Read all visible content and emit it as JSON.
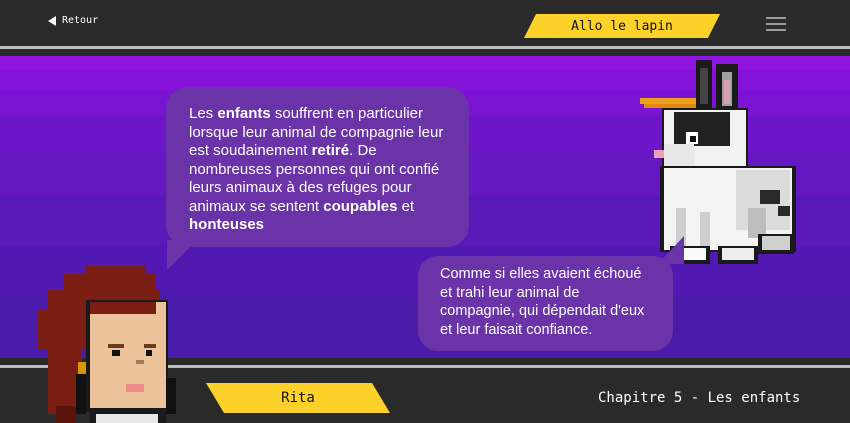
{
  "header": {
    "back_label": "Retour",
    "title": "Allo le lapin"
  },
  "dialogue": {
    "bubble1": {
      "p1": "Les ",
      "b1": "enfants",
      "p2": " souffrent en particulier lorsque leur animal de compagnie leur est soudainement ",
      "b2": "retiré",
      "p3": ". De nombreuses personnes qui ont confié leurs animaux à des refuges pour animaux se sentent ",
      "b3": "coupables",
      "p4": " et ",
      "b4": "honteuses"
    },
    "bubble2": "Comme si elles avaient échoué et trahi leur animal de compagnie, qui dépendait d'eux et leur faisait confiance."
  },
  "footer": {
    "speaker": "Rita",
    "chapter": "Chapitre 5 - Les enfants"
  },
  "icons": {
    "back": "back-arrow-icon",
    "menu": "hamburger-menu-icon"
  },
  "colors": {
    "accent": "#fcd12a",
    "bubble": "#6a34a8",
    "bar": "#2a2a2a"
  }
}
